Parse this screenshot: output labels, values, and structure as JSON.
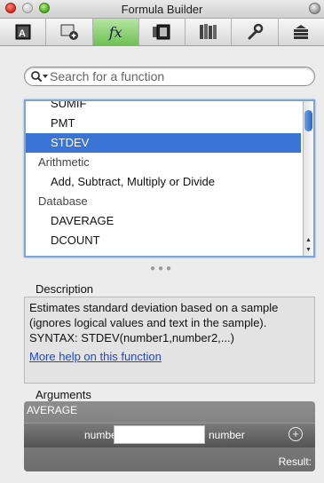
{
  "window": {
    "title": "Formula Builder"
  },
  "search": {
    "placeholder": "Search for a function"
  },
  "function_list": {
    "rows": [
      {
        "label": "SUMIF",
        "kind": "item"
      },
      {
        "label": "PMT",
        "kind": "item"
      },
      {
        "label": "STDEV",
        "kind": "item",
        "selected": true
      },
      {
        "label": "Arithmetic",
        "kind": "category"
      },
      {
        "label": "Add, Subtract, Multiply or Divide",
        "kind": "item"
      },
      {
        "label": "Database",
        "kind": "category"
      },
      {
        "label": "DAVERAGE",
        "kind": "item"
      },
      {
        "label": "DCOUNT",
        "kind": "item"
      }
    ]
  },
  "description": {
    "header": "Description",
    "text": "Estimates standard deviation based on a sample (ignores logical values and text in the sample).",
    "syntax": "SYNTAX:  STDEV(number1,number2,...)",
    "help_link": "More help on this function"
  },
  "arguments": {
    "header": "Arguments",
    "function_name": "AVERAGE",
    "arg_name": "number1",
    "arg_value": "",
    "arg_type": "number",
    "result_label": "Result:"
  },
  "colors": {
    "selection": "#3a74d4",
    "active_tool": "#7fcb62",
    "link": "#1d45d8"
  }
}
